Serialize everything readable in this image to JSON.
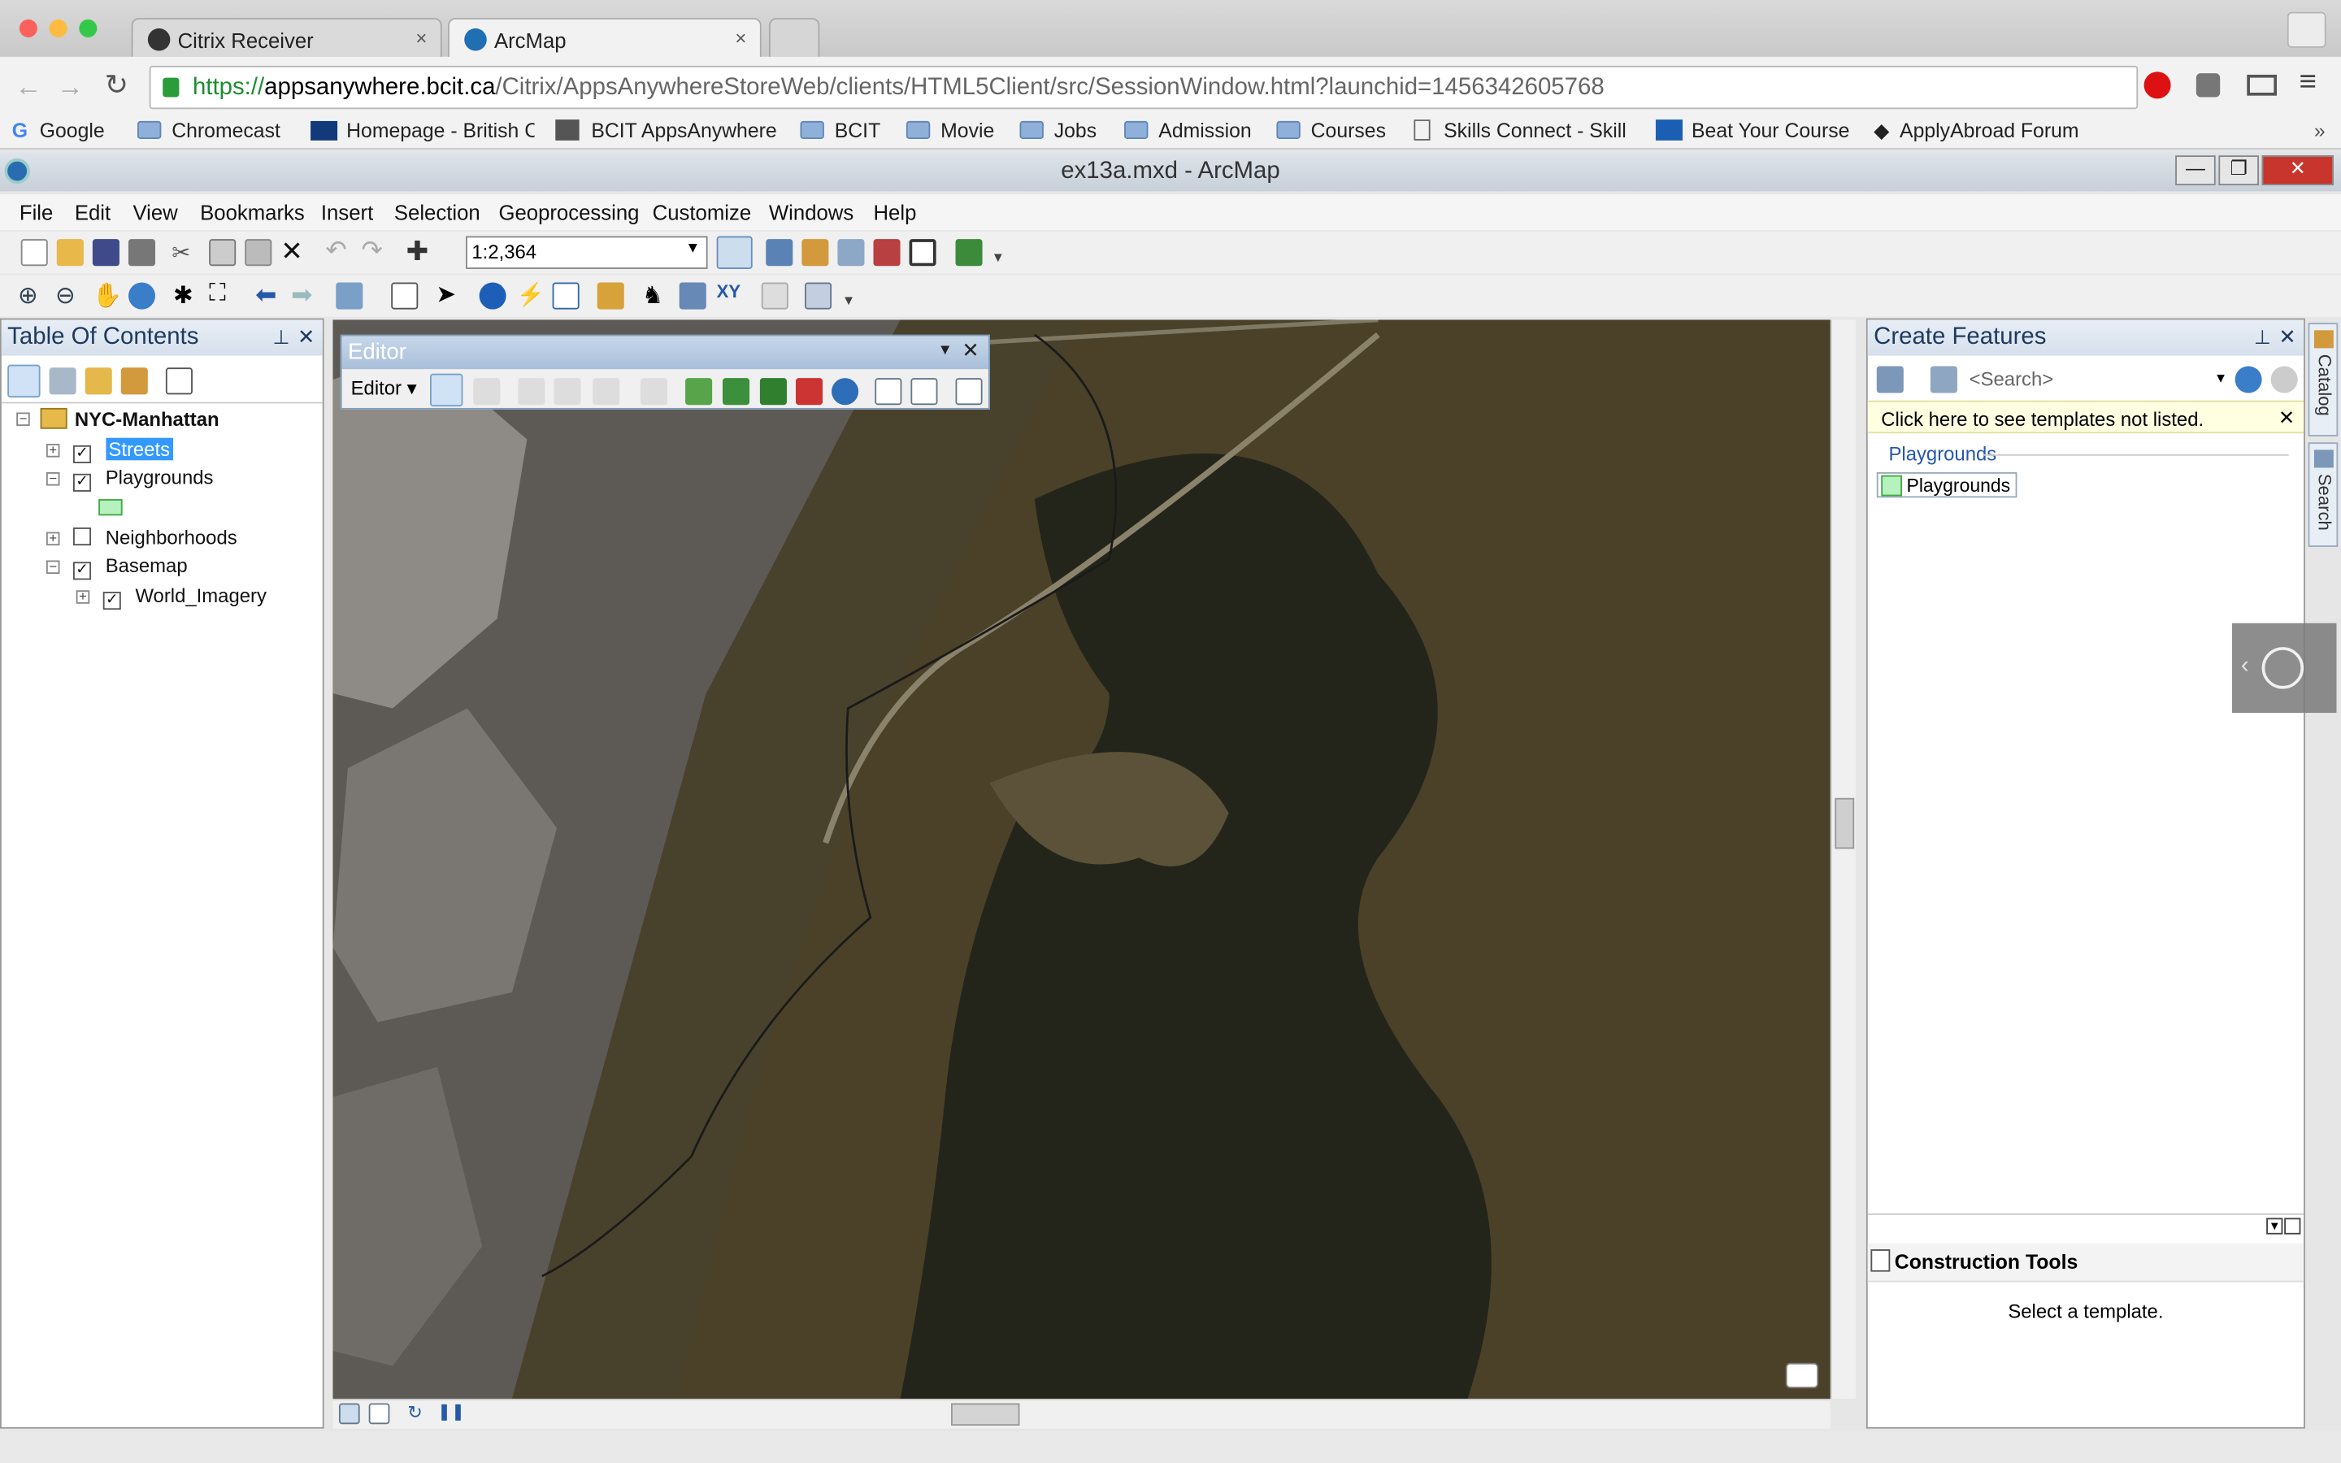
{
  "browser": {
    "tabs": [
      {
        "label": "Citrix Receiver",
        "close": "×"
      },
      {
        "label": "ArcMap",
        "close": "×"
      }
    ],
    "url": {
      "scheme": "https://",
      "host": "appsanywhere.bcit.ca",
      "path": "/Citrix/AppsAnywhereStoreWeb/clients/HTML5Client/src/SessionWindow.html?launchid=1456342605768"
    },
    "bookmarks": [
      {
        "label": "Google",
        "icon": "google-icon"
      },
      {
        "label": "Chromecast",
        "icon": "folder-icon"
      },
      {
        "label": "Homepage - British C",
        "icon": "bcit-icon"
      },
      {
        "label": "BCIT AppsAnywhere",
        "icon": "appsanywhere-icon"
      },
      {
        "label": "BCIT",
        "icon": "folder-icon"
      },
      {
        "label": "Movie",
        "icon": "folder-icon"
      },
      {
        "label": "Jobs",
        "icon": "folder-icon"
      },
      {
        "label": "Admission",
        "icon": "folder-icon"
      },
      {
        "label": "Courses",
        "icon": "folder-icon"
      },
      {
        "label": "Skills Connect - Skill",
        "icon": "page-icon"
      },
      {
        "label": "Beat Your Course",
        "icon": "byc-icon"
      },
      {
        "label": "ApplyAbroad Forum",
        "icon": "graduation-icon"
      }
    ],
    "bookmarks_more": "»"
  },
  "window": {
    "title": "ex13a.mxd - ArcMap",
    "min": "—",
    "max": "❐",
    "close": "✕"
  },
  "menu": [
    "File",
    "Edit",
    "View",
    "Bookmarks",
    "Insert",
    "Selection",
    "Geoprocessing",
    "Customize",
    "Windows",
    "Help"
  ],
  "scale": "1:2,364",
  "toc": {
    "title": "Table Of Contents",
    "data_frame": "NYC-Manhattan",
    "layers": [
      {
        "name": "Streets",
        "checked": true,
        "selected": true
      },
      {
        "name": "Playgrounds",
        "checked": true
      },
      {
        "name": "Neighborhoods",
        "checked": false
      },
      {
        "name": "Basemap",
        "checked": true
      },
      {
        "name": "World_Imagery",
        "checked": true
      }
    ],
    "swatch_color": "#b6f2c0"
  },
  "editor": {
    "title": "Editor",
    "menu_label": "Editor ▾"
  },
  "create_features": {
    "title": "Create Features",
    "search_placeholder": "<Search>",
    "notice": "Click here to see templates not listed.",
    "group": "Playgrounds",
    "template": "Playgrounds",
    "template_color": "#b6f2c0"
  },
  "construction_tools": {
    "title": "Construction Tools",
    "message": "Select a template."
  },
  "side_tabs": [
    "Catalog",
    "Search"
  ],
  "colors": {
    "accent": "#3399ff",
    "notice_bg": "#ffffe1",
    "panel_header": "#dbe5f1"
  }
}
